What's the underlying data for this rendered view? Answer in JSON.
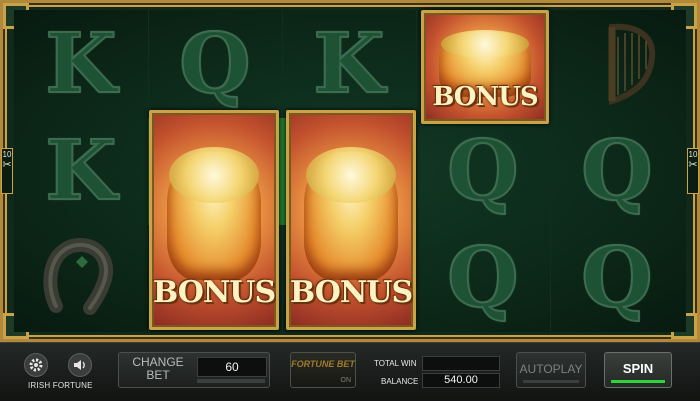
{
  "reels": {
    "row1": [
      "K",
      "Q",
      "K",
      "",
      ""
    ],
    "row2": [
      "K",
      "",
      "",
      "Q",
      "Q"
    ],
    "row3": [
      "",
      "",
      "",
      "Q",
      "Q"
    ],
    "bonus_label": "BONUS",
    "line_marker": {
      "number": "10",
      "glyph": "✂"
    }
  },
  "controls": {
    "game_name": "IRISH FORTUNE",
    "change_bet_label": "CHANGE BET",
    "bet_value": "60",
    "fortune_bet_label": "FORTUNE BET",
    "fortune_bet_state": "ON",
    "total_win_label": "TOTAL WIN",
    "total_win_value": "",
    "balance_label": "BALANCE",
    "balance_value": "540.00",
    "autoplay_label": "AUTOPLAY",
    "spin_label": "SPIN"
  },
  "icons": {
    "settings": "gear-icon",
    "sound": "speaker-icon",
    "harp": "harp-icon",
    "horseshoe": "horseshoe-icon"
  },
  "colors": {
    "frame_gold": "#c9a24a",
    "reel_bg": "#0b2516",
    "spin_accent": "#2fd23a",
    "bonus_orange": "#e89142"
  }
}
